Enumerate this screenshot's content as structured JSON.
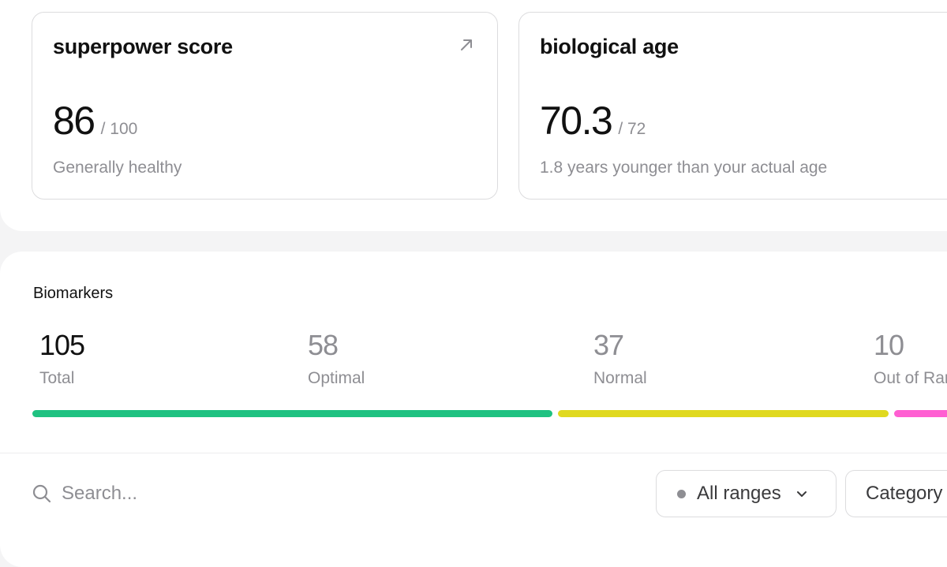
{
  "cards": {
    "score": {
      "title": "superpower score",
      "value": "86",
      "max": "/ 100",
      "subtitle": "Generally healthy",
      "link_icon": "arrow-up-right-icon"
    },
    "bio_age": {
      "title": "biological age",
      "value": "70.3",
      "max": "/ 72",
      "subtitle": "1.8 years younger than your actual age",
      "link_icon": "arrow-up-right-icon"
    }
  },
  "biomarkers": {
    "title": "Biomarkers",
    "total": {
      "value": "105",
      "label": "Total"
    },
    "optimal": {
      "value": "58",
      "label": "Optimal",
      "color": "#1fc281"
    },
    "normal": {
      "value": "37",
      "label": "Normal",
      "color": "#e0d91f"
    },
    "out_of_range": {
      "value": "10",
      "label": "Out of Range",
      "color": "#ff5fd2"
    }
  },
  "controls": {
    "search": {
      "placeholder": "Search...",
      "icon": "search-icon"
    },
    "ranges_filter": {
      "label": "All ranges",
      "icon": "chevron-down-icon"
    },
    "category_filter": {
      "label": "Category"
    }
  }
}
